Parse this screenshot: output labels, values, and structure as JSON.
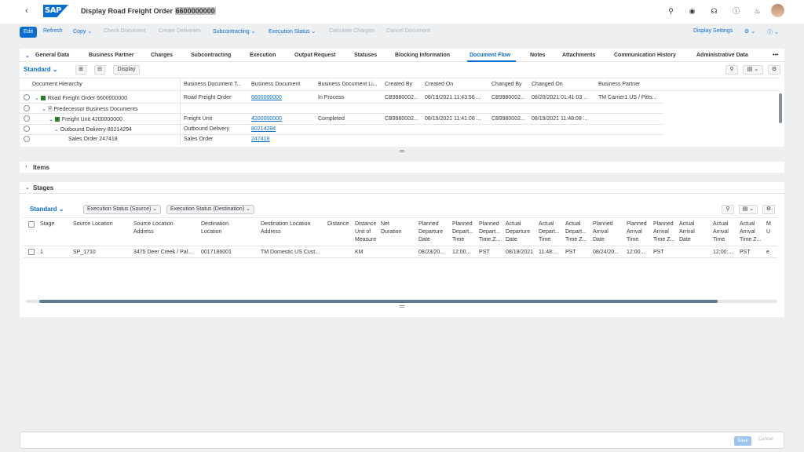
{
  "shell": {
    "back_icon": "chevron-left-icon",
    "logo_text": "SAP",
    "title_prefix": "Display Road Freight Order",
    "title_number": "6600000000",
    "icons": [
      "search-icon",
      "copilot-icon",
      "headset-icon",
      "help-icon",
      "bell-icon"
    ]
  },
  "actions": {
    "edit": "Edit",
    "refresh": "Refresh",
    "copy": "Copy",
    "check_document": "Check Document",
    "create_deliveries": "Create Deliveries",
    "subcontracting": "Subcontracting",
    "execution_status": "Execution Status",
    "calculate_charges": "Calculate Charges",
    "cancel_document": "Cancel Document",
    "display_settings": "Display Settings"
  },
  "tabs": [
    "General Data",
    "Business Partner",
    "Charges",
    "Subcontracting",
    "Execution",
    "Output Request",
    "Statuses",
    "Blocking Information",
    "Document Flow",
    "Notes",
    "Attachments",
    "Communication History",
    "Administrative Data"
  ],
  "active_tab": "Document Flow",
  "doc_flow": {
    "variant": "Standard",
    "display_button": "Display",
    "columns": [
      "Document Hierarchy",
      "Business Document T...",
      "Business Document",
      "Business Document Li...",
      "Created By",
      "Created On",
      "Changed By",
      "Changed On",
      "Business Partner"
    ],
    "rows": [
      {
        "hierarchy": "Road Freight Order 6600000000",
        "type": "Road Freight Order",
        "doc": "6600000000",
        "lifecycle": "In Process",
        "created_by": "CB9980002...",
        "created_on": "08/19/2021 11:43:56 ...",
        "changed_by": "CB9980002...",
        "changed_on": "08/20/2021 01:41:03 ...",
        "partner": "TM Carrier1 US / Pitts..."
      },
      {
        "hierarchy": "Predecessor Business Documents",
        "type": "",
        "doc": "",
        "lifecycle": "",
        "created_by": "",
        "created_on": "",
        "changed_by": "",
        "changed_on": "",
        "partner": ""
      },
      {
        "hierarchy": "Freight Unit 4200000000",
        "type": "Freight Unit",
        "doc": "4200000000",
        "lifecycle": "Completed",
        "created_by": "CB9980002...",
        "created_on": "08/19/2021 11:41:06 ...",
        "changed_by": "CB9980002...",
        "changed_on": "08/19/2021 11:48:08 ...",
        "partner": ""
      },
      {
        "hierarchy": "Outbound Delivery 80214294",
        "type": "Outbound Delivery",
        "doc": "80214294",
        "lifecycle": "",
        "created_by": "",
        "created_on": "",
        "changed_by": "",
        "changed_on": "",
        "partner": ""
      },
      {
        "hierarchy": "Sales Order 247418",
        "type": "Sales Order",
        "doc": "247418",
        "lifecycle": "",
        "created_by": "",
        "created_on": "",
        "changed_by": "",
        "changed_on": "",
        "partner": ""
      }
    ]
  },
  "items_section": "Items",
  "stages_section": "Stages",
  "stages": {
    "variant": "Standard",
    "filter_source": "Execution Status (Source)",
    "filter_destination": "Execution Status (Destination)",
    "columns": [
      "Stage",
      "Source Location",
      "Source Location Address",
      "Destination Location",
      "Destination Location Address",
      "Distance",
      "Distance Unit of Measure",
      "Net Duration",
      "Planned Departure Date",
      "Planned Depart... Time",
      "Planned Depart... Time Z...",
      "Actual Departure Date",
      "Actual Depart... Time",
      "Actual Depart... Time Z...",
      "Planned Arrival Date",
      "Planned Arrival Time",
      "Planned Arrival Time Z...",
      "Actual Arrival Date",
      "Actual Arrival Time",
      "Actual Arrival Time Z...",
      "M U"
    ],
    "row": [
      "1",
      "SP_1710",
      "3475 Deer Creek / Pal...",
      "0017186001",
      "TM Domestic US Cust...",
      "",
      "KM",
      "",
      "08/23/20...",
      "12:00...",
      "PST",
      "08/19/2021",
      "11:48:...",
      "PST",
      "08/24/20...",
      "12:00...",
      "PST",
      "",
      "12:00:...",
      "PST",
      "e"
    ]
  },
  "footer": {
    "save": "Save",
    "cancel": "Cancel"
  }
}
